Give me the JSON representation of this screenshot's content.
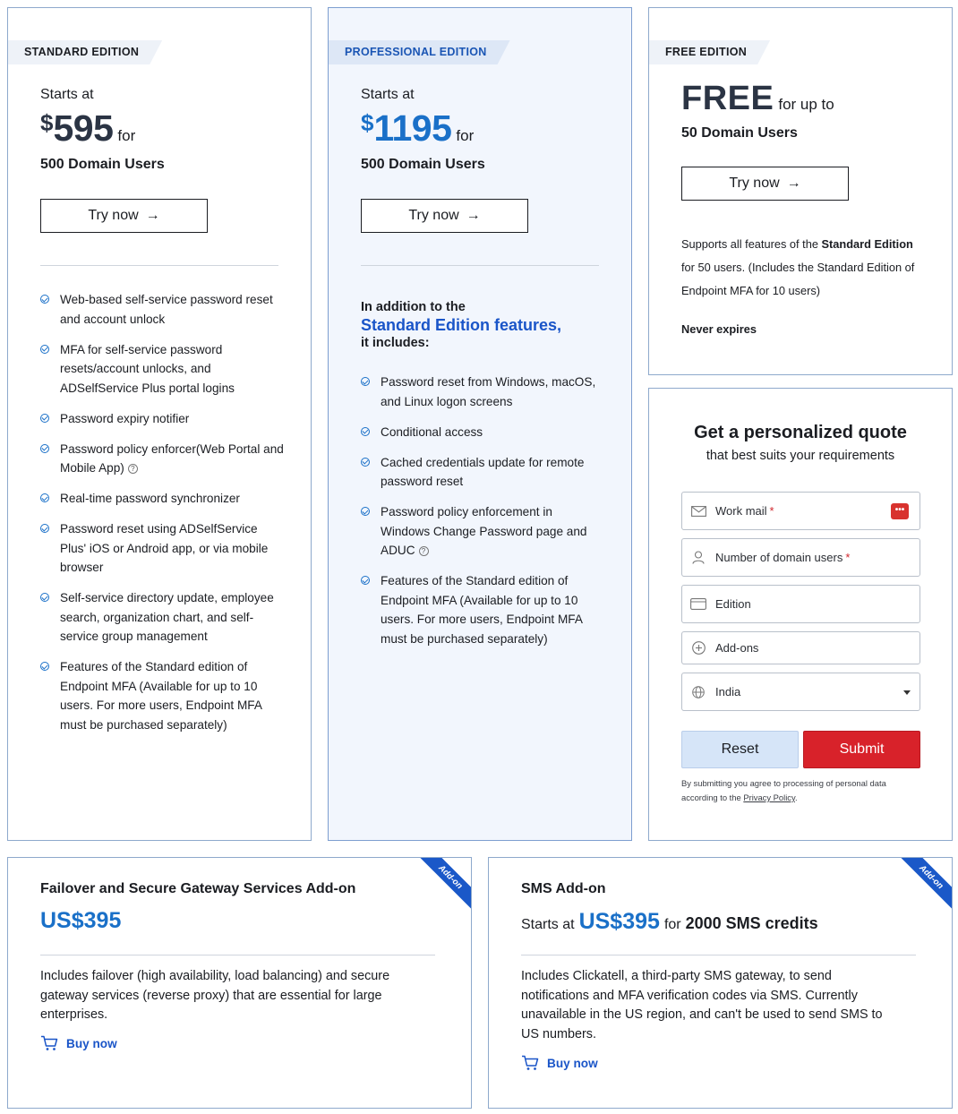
{
  "standard": {
    "ribbon": "STANDARD EDITION",
    "starts_at": "Starts at",
    "currency": "$",
    "amount": "595",
    "for": "for",
    "users": "500 Domain Users",
    "try_label": "Try now",
    "features": [
      "Web-based self-service password reset and account unlock",
      "MFA for self-service password resets/account unlocks, and ADSelfService Plus portal logins",
      "Password expiry notifier",
      "Password policy enforcer(Web Portal and Mobile App)",
      "Real-time password synchronizer",
      "Password reset using ADSelfService Plus' iOS or Android app, or via mobile browser",
      "Self-service directory update, employee search, organization chart, and self-service group management",
      "Features of the Standard edition of Endpoint MFA (Available for up to 10 users. For more users, Endpoint MFA must be purchased separately)"
    ]
  },
  "professional": {
    "ribbon": "PROFESSIONAL EDITION",
    "starts_at": "Starts at",
    "currency": "$",
    "amount": "1195",
    "for": "for",
    "users": "500 Domain Users",
    "try_label": "Try now",
    "intro_1": "In addition to the",
    "intro_2": "Standard Edition features,",
    "intro_3": "it includes:",
    "features": [
      "Password reset from Windows, macOS, and Linux logon screens",
      "Conditional access",
      "Cached credentials update for remote password reset",
      "Password policy enforcement in Windows Change Password page and ADUC",
      "Features of the Standard edition of Endpoint MFA (Available for up to 10 users. For more users, Endpoint MFA must be purchased separately)"
    ]
  },
  "free": {
    "ribbon": "FREE EDITION",
    "big": "FREE",
    "upto": "for up to",
    "users": "50 Domain Users",
    "try_label": "Try now",
    "desc_1": "Supports all features of the ",
    "desc_bold_1": "Standard Edition",
    "desc_2": " for 50 users. (Includes the Standard Edition of Endpoint MFA for 10 users)",
    "never": "Never expires"
  },
  "quote": {
    "title": "Get a personalized quote",
    "subtitle": "that best suits your requirements",
    "work_mail": "Work mail",
    "domain_users": "Number of domain users",
    "required_mark": "*",
    "edition": "Edition",
    "addons": "Add-ons",
    "country": "India",
    "pw_badge": "•••",
    "reset_label": "Reset",
    "submit_label": "Submit",
    "consent_1": "By submitting you agree to processing of personal data according to the ",
    "privacy_link": "Privacy Policy",
    "consent_2": "."
  },
  "addon_failover": {
    "title": "Failover and Secure Gateway Services Add-on",
    "price": "US$395",
    "desc": "Includes failover (high availability, load balancing) and secure gateway services (reverse proxy) that are essential for large enterprises.",
    "buy_label": "Buy now",
    "corner": "Add-on"
  },
  "addon_sms": {
    "title": "SMS Add-on",
    "starts_at": "Starts at",
    "price": "US$395",
    "for": "for",
    "credits": "2000 SMS credits",
    "desc": "Includes Clickatell, a third-party SMS gateway, to send notifications and MFA verification codes via SMS. Currently unavailable in the US region, and can't be used to send SMS to US numbers.",
    "buy_label": "Buy now",
    "corner": "Add-on"
  },
  "colors": {
    "accent_blue": "#1a70c8",
    "link_blue": "#1a55c8",
    "submit_red": "#d8222a",
    "reset_blue": "#d6e5f8",
    "card_border": "#8ea9cc"
  }
}
